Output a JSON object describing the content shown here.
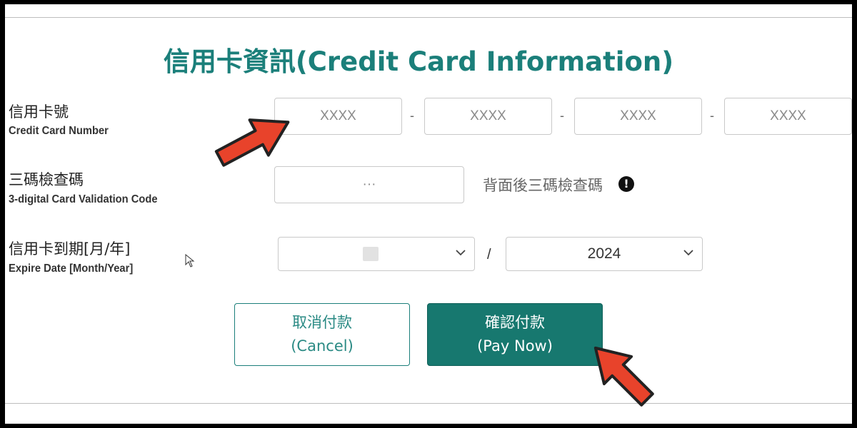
{
  "title": "信用卡資訊(Credit Card Information)",
  "card_number": {
    "label_zh": "信用卡號",
    "label_en": "Credit Card Number",
    "separator": "-",
    "fields": [
      {
        "placeholder": "XXXX"
      },
      {
        "placeholder": "XXXX"
      },
      {
        "placeholder": "XXXX"
      },
      {
        "placeholder": "XXXX"
      }
    ]
  },
  "cvv": {
    "label_zh": "三碼檢查碼",
    "label_en": "3-digital Card Validation Code",
    "placeholder": "···",
    "hint": "背面後三碼檢查碼",
    "info_icon": "exclamation-circle-icon"
  },
  "expiry": {
    "label_zh": "信用卡到期[月/年]",
    "label_en": "Expire Date [Month/Year]",
    "month_value": "",
    "separator": "/",
    "year_value": "2024"
  },
  "buttons": {
    "cancel_line1": "取消付款",
    "cancel_line2": "(Cancel)",
    "pay_line1": "確認付款",
    "pay_line2": "(Pay Now)"
  },
  "colors": {
    "accent": "#1b7f7a",
    "pay_button": "#17786f",
    "arrow": "#e8432b"
  }
}
